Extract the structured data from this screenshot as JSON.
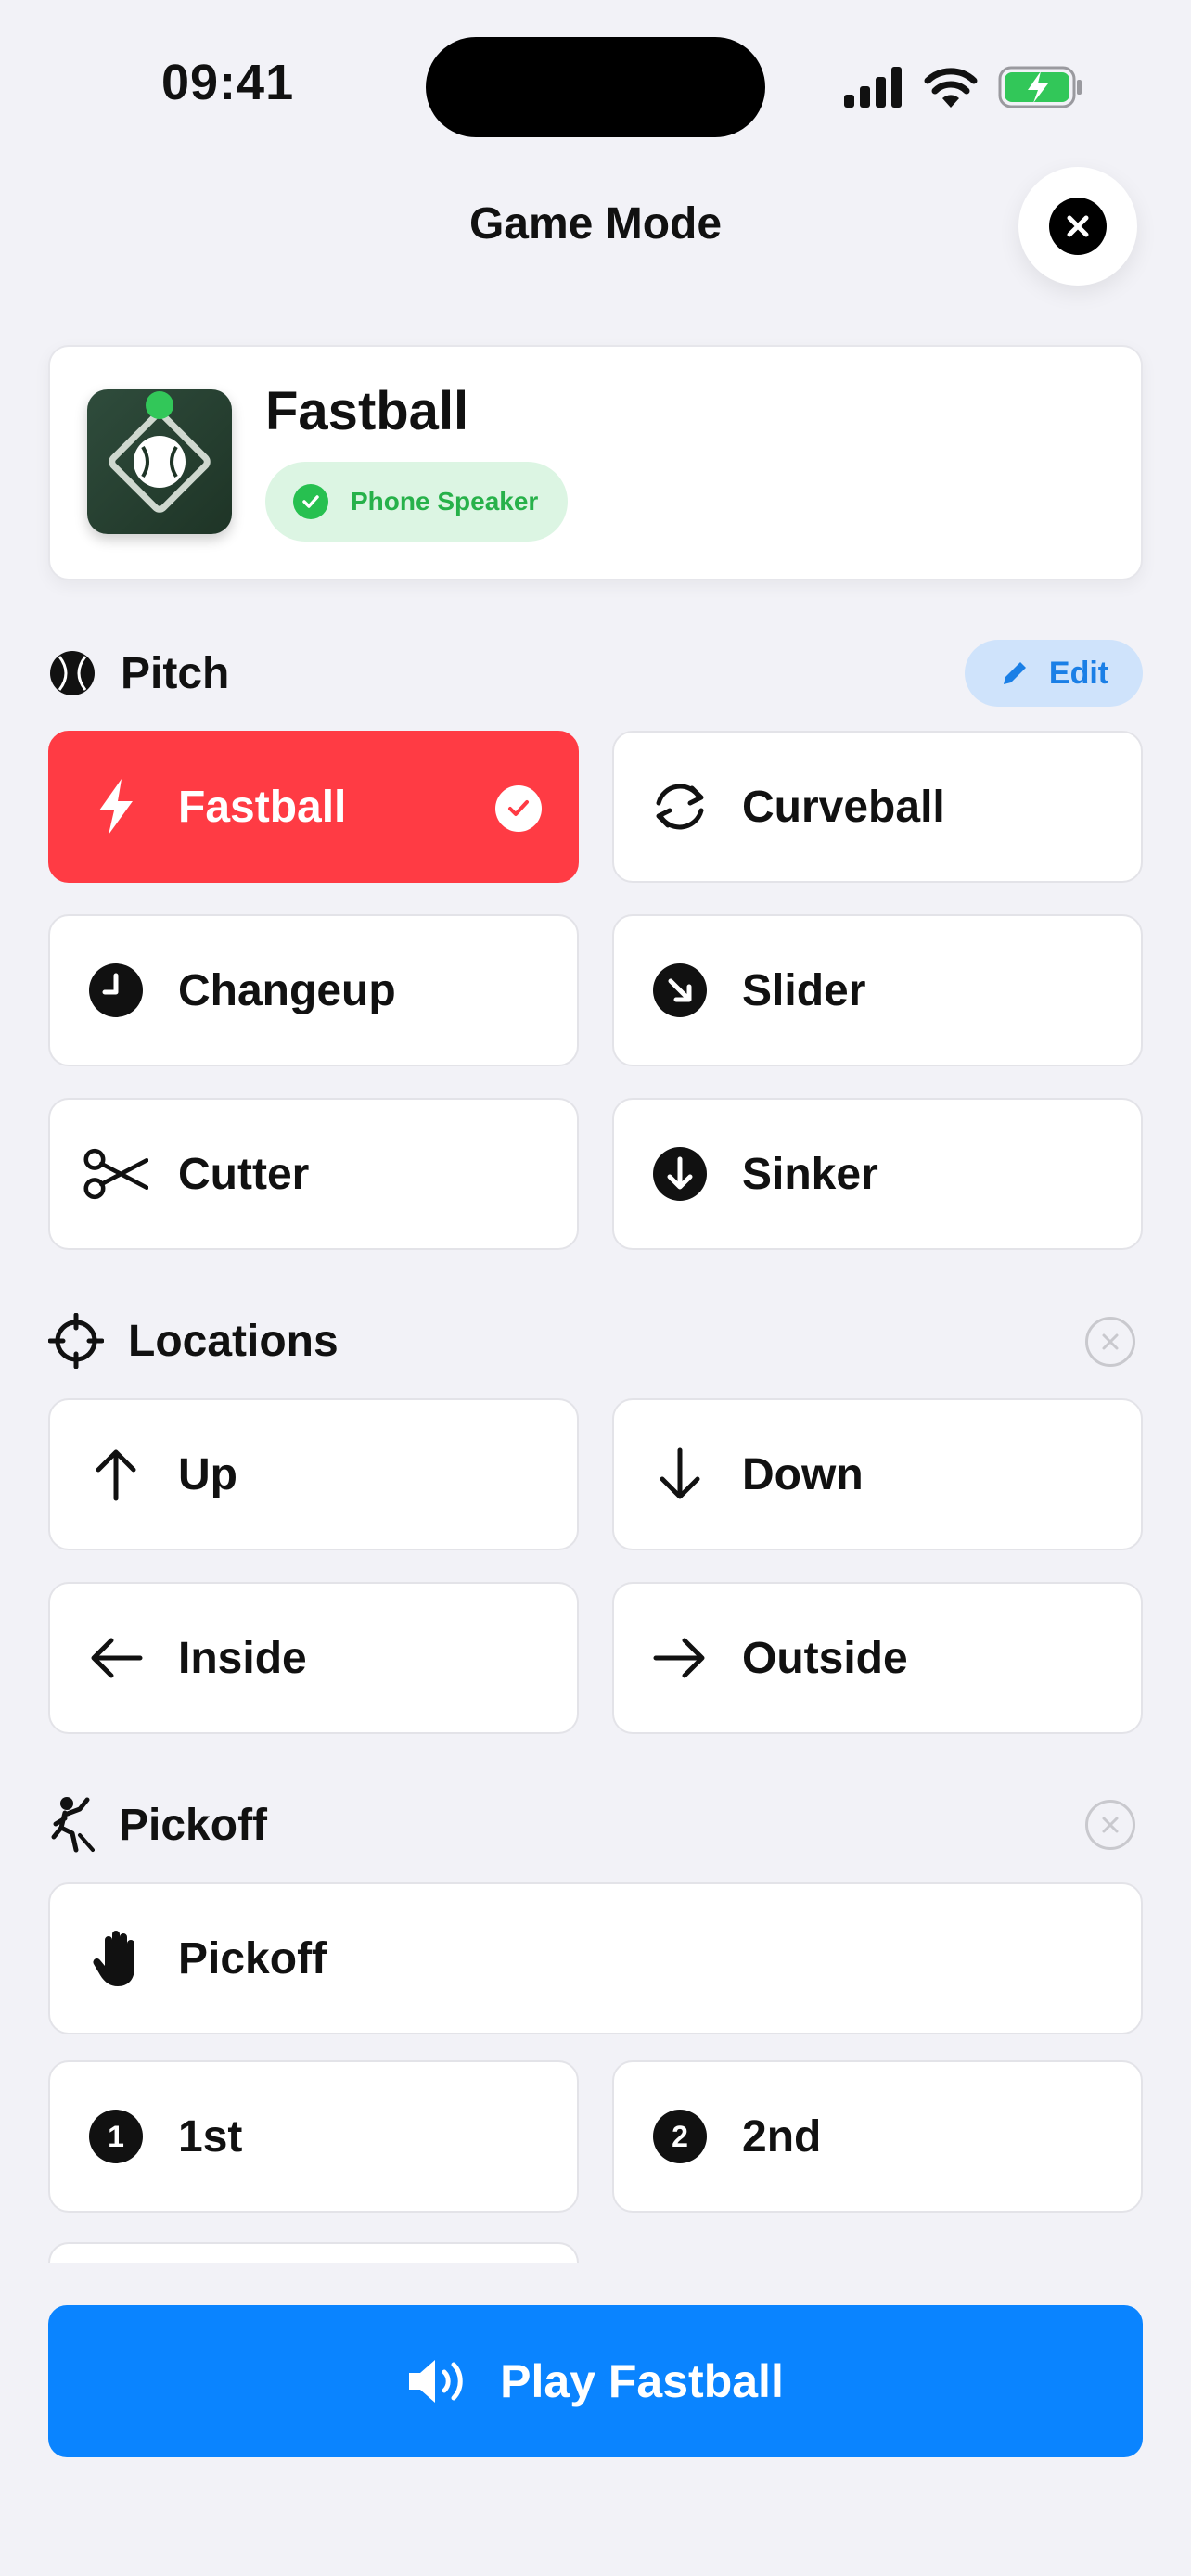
{
  "status_bar": {
    "time": "09:41"
  },
  "header": {
    "title": "Game Mode"
  },
  "current": {
    "title": "Fastball",
    "output": "Phone Speaker"
  },
  "pitch": {
    "label": "Pitch",
    "edit_label": "Edit",
    "items": [
      {
        "label": "Fastball",
        "icon": "bolt-icon",
        "selected": true
      },
      {
        "label": "Curveball",
        "icon": "rotate-icon"
      },
      {
        "label": "Changeup",
        "icon": "clock-icon"
      },
      {
        "label": "Slider",
        "icon": "arrow-down-right-circle-icon"
      },
      {
        "label": "Cutter",
        "icon": "scissors-icon"
      },
      {
        "label": "Sinker",
        "icon": "arrow-down-circle-icon"
      }
    ]
  },
  "locations": {
    "label": "Locations",
    "items": [
      {
        "label": "Up",
        "icon": "arrow-up-icon"
      },
      {
        "label": "Down",
        "icon": "arrow-down-icon"
      },
      {
        "label": "Inside",
        "icon": "arrow-left-icon"
      },
      {
        "label": "Outside",
        "icon": "arrow-right-icon"
      }
    ]
  },
  "pickoff": {
    "label": "Pickoff",
    "items": [
      {
        "label": "Pickoff",
        "icon": "hand-raised-icon"
      },
      {
        "label": "1st",
        "icon": "number-1-circle-icon"
      },
      {
        "label": "2nd",
        "icon": "number-2-circle-icon"
      }
    ]
  },
  "play_button": {
    "label": "Play Fastball"
  },
  "colors": {
    "accent_red": "#FF3B44",
    "accent_blue": "#0A84FF",
    "success_green": "#27C050"
  }
}
